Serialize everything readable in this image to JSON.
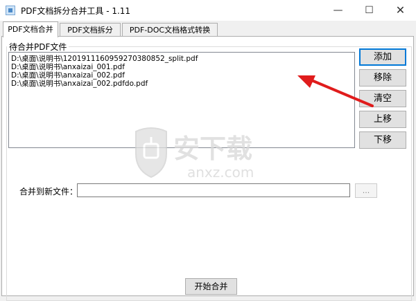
{
  "window": {
    "title": "PDF文档拆分合并工具 - 1.11",
    "minimize_glyph": "—",
    "maximize_glyph": "☐",
    "close_glyph": "✕"
  },
  "tabs": [
    {
      "label": "PDF文档合并",
      "active": true
    },
    {
      "label": "PDF文档拆分",
      "active": false
    },
    {
      "label": "PDF-DOC文档格式转换",
      "active": false
    }
  ],
  "file_group": {
    "legend": "待合并PDF文件",
    "files": [
      "D:\\桌面\\说明书\\1201911160959270380852_split.pdf",
      "D:\\桌面\\说明书\\anxaizai_001.pdf",
      "D:\\桌面\\说明书\\anxaizai_002.pdf",
      "D:\\桌面\\说明书\\anxaizai_002.pdfdo.pdf"
    ]
  },
  "buttons": {
    "add": "添加",
    "remove": "移除",
    "clear": "清空",
    "up": "上移",
    "down": "下移"
  },
  "merge": {
    "label": "合并到新文件：",
    "value": "",
    "browse": "..."
  },
  "start_button": "开始合并",
  "watermark": {
    "title": "安下载",
    "url": "anxz.com"
  },
  "colors": {
    "annotation_arrow": "#e01c1c",
    "focus_border": "#0078d7"
  }
}
